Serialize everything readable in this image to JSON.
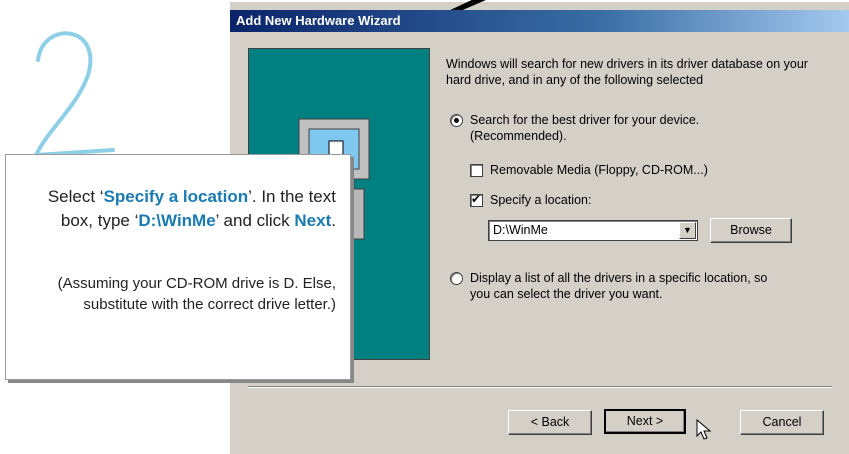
{
  "step_number": "2",
  "window": {
    "title": "Add New Hardware Wizard"
  },
  "intro_text": "Windows will search for new drivers in its driver database on your hard drive, and in any of the following selected",
  "search_option": {
    "label_line1": "Search for the best driver for your device.",
    "label_line2": "(Recommended).",
    "selected": true
  },
  "removable_media": {
    "label": "Removable Media (Floppy, CD-ROM...)",
    "checked": false
  },
  "specify_location": {
    "label": "Specify a location:",
    "checked": true
  },
  "location_combo": {
    "value": "D:\\WinMe"
  },
  "browse_button": "Browse",
  "display_list_option": {
    "label_line1": "Display a list of all the drivers in a specific location, so",
    "label_line2": "you can select the driver you want.",
    "selected": false
  },
  "buttons": {
    "back": "< Back",
    "next": "Next >",
    "cancel": "Cancel"
  },
  "callout": {
    "part1": "Select ‘",
    "highlight1": "Specify a location",
    "part2": "’.  In the text box, type ‘",
    "highlight2": "D:\\WinMe",
    "part3": "’ and click ",
    "highlight3": "Next",
    "part4": ".",
    "note": "(Assuming your CD-ROM drive is D. Else, substitute with the correct drive letter.)"
  },
  "colors": {
    "highlight": "#1a7bb3",
    "titlebar_start": "#0a246a",
    "titlebar_end": "#a6caf0",
    "teal": "#008080",
    "dialog_bg": "#d4d0c8"
  }
}
